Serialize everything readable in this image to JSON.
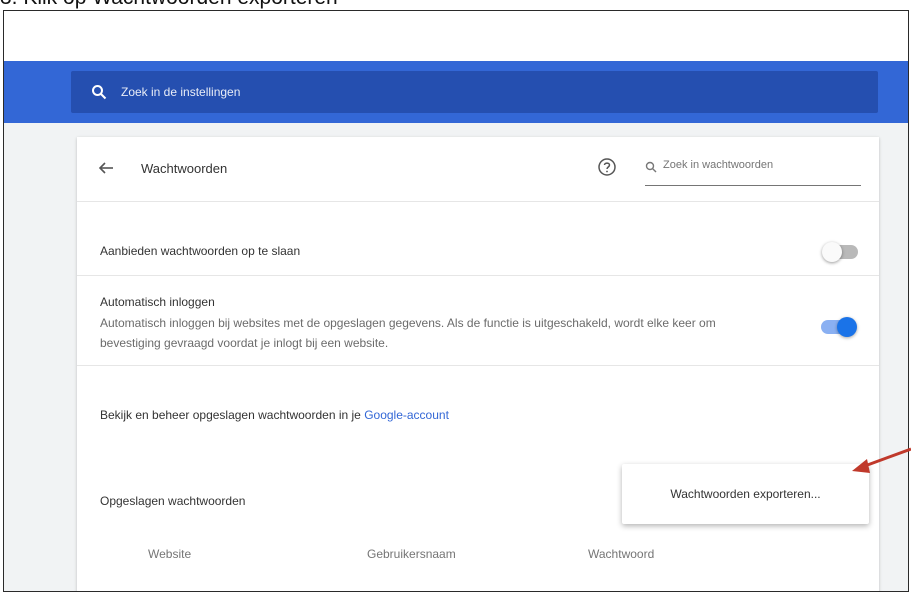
{
  "caption": "3. Klik op Wachtwoorden exporteren",
  "settings_search": {
    "placeholder": "Zoek in de instellingen"
  },
  "page": {
    "title": "Wachtwoorden",
    "password_search_placeholder": "Zoek in wachtwoorden"
  },
  "offer_save": {
    "label": "Aanbieden wachtwoorden op te slaan",
    "enabled": false
  },
  "auto_signin": {
    "label": "Automatisch inloggen",
    "description": "Automatisch inloggen bij websites met de opgeslagen gegevens. Als de functie is uitgeschakeld, wordt elke keer om bevestiging gevraagd voordat je inlogt bij een website.",
    "enabled": true
  },
  "manage": {
    "text": "Bekijk en beheer opgeslagen wachtwoorden in je ",
    "link": "Google-account"
  },
  "saved": {
    "heading": "Opgeslagen wachtwoorden"
  },
  "menu": {
    "export_label": "Wachtwoorden exporteren..."
  },
  "columns": [
    "Website",
    "Gebruikersnaam",
    "Wachtwoord"
  ],
  "colors": {
    "header_blue": "#3367d6",
    "search_blue": "#254fb0",
    "toggle_on": "#1a73e8",
    "arrow_red": "#c0392b"
  },
  "icons": [
    "search-icon",
    "back-arrow-icon",
    "help-icon",
    "red-pointer-arrow"
  ]
}
